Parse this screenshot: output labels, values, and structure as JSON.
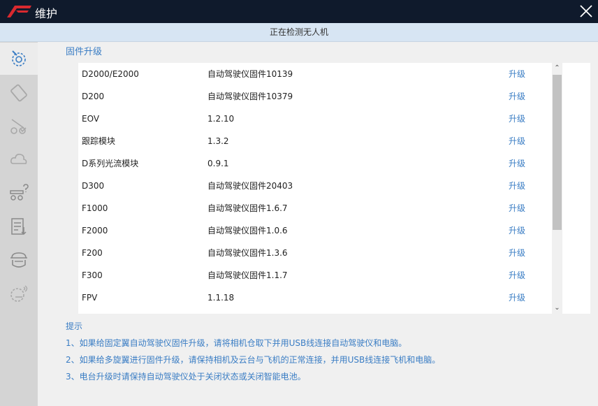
{
  "window": {
    "title": "维护",
    "logo_icon": "red-wing-logo",
    "close_icon": "close-icon"
  },
  "status": {
    "text": "正在检测无人机"
  },
  "sidebar": {
    "items": [
      {
        "icon": "gear-maintenance-icon",
        "active": true
      },
      {
        "icon": "battery-icon",
        "active": false
      },
      {
        "icon": "drone-check-icon",
        "active": false
      },
      {
        "icon": "cloud-icon",
        "active": false
      },
      {
        "icon": "gimbal-help-icon",
        "active": false
      },
      {
        "icon": "log-list-icon",
        "active": false
      },
      {
        "icon": "payload-pod-icon",
        "active": false
      },
      {
        "icon": "settings-wireless-icon",
        "active": false
      }
    ]
  },
  "firmware": {
    "title": "固件升级",
    "action_label": "升级",
    "rows": [
      {
        "name": "D2000/E2000",
        "version": "自动驾驶仪固件10139"
      },
      {
        "name": "D200",
        "version": "自动驾驶仪固件10379"
      },
      {
        "name": "EOV",
        "version": "1.2.10"
      },
      {
        "name": "跟踪模块",
        "version": "1.3.2"
      },
      {
        "name": "D系列光流模块",
        "version": "0.9.1"
      },
      {
        "name": "D300",
        "version": "自动驾驶仪固件20403"
      },
      {
        "name": "F1000",
        "version": "自动驾驶仪固件1.6.7"
      },
      {
        "name": "F2000",
        "version": "自动驾驶仪固件1.0.6"
      },
      {
        "name": "F200",
        "version": "自动驾驶仪固件1.3.6"
      },
      {
        "name": "F300",
        "version": "自动驾驶仪固件1.1.7"
      },
      {
        "name": "FPV",
        "version": "1.1.18"
      }
    ]
  },
  "tips": {
    "heading": "提示",
    "lines": [
      "1、如果给固定翼自动驾驶仪固件升级，请将相机仓取下并用USB线连接自动驾驶仪和电脑。",
      "2、如果给多旋翼进行固件升级，请保持相机及云台与飞机的正常连接，并用USB线连接飞机和电脑。",
      "3、电台升级时请保持自动驾驶仪处于关闭状态或关闭智能电池。"
    ]
  },
  "colors": {
    "titlebar": "#0f1a2c",
    "accent": "#3a7dc4",
    "status_bar": "#d7e5f3",
    "sidebar": "#d4d4d4"
  }
}
